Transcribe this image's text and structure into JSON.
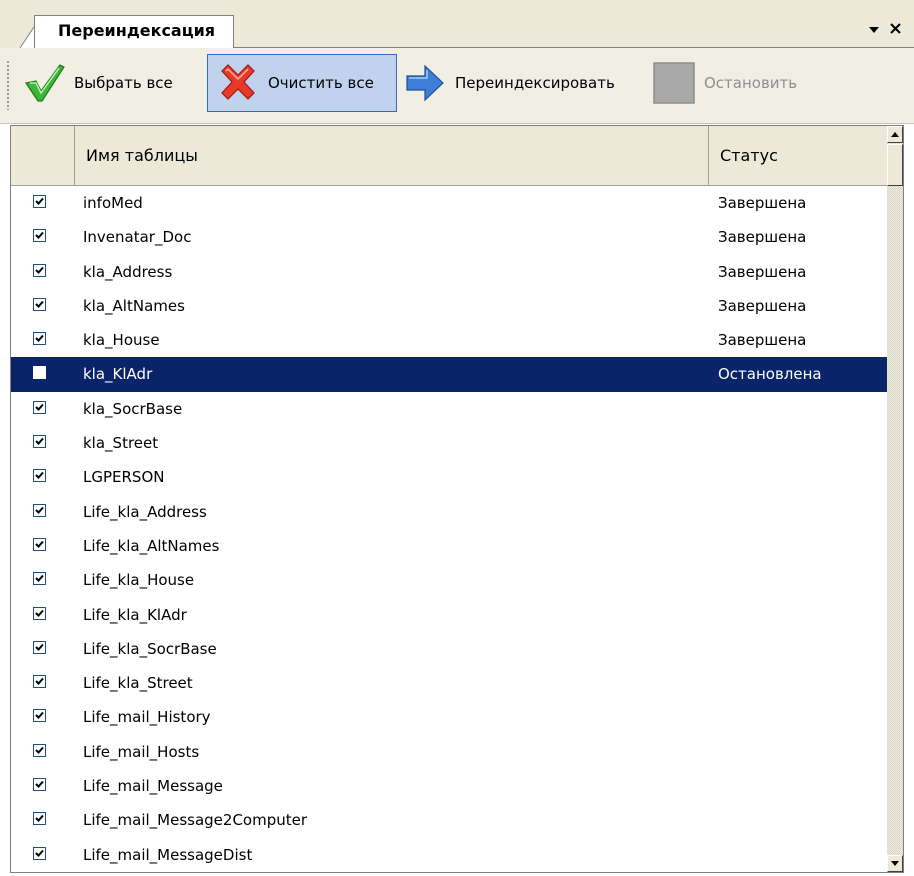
{
  "tab": {
    "title": "Переиндексация"
  },
  "toolbar": {
    "select_all": "Выбрать все",
    "clear_all": "Очистить все",
    "reindex": "Переиндексировать",
    "stop": "Остановить"
  },
  "table": {
    "columns": [
      "",
      "Имя таблицы",
      "Статус"
    ],
    "rows": [
      {
        "checked": true,
        "name": "infoMed",
        "status": "Завершена"
      },
      {
        "checked": true,
        "name": "Invenatar_Doc",
        "status": "Завершена"
      },
      {
        "checked": true,
        "name": "kla_Address",
        "status": "Завершена"
      },
      {
        "checked": true,
        "name": "kla_AltNames",
        "status": "Завершена"
      },
      {
        "checked": true,
        "name": "kla_House",
        "status": "Завершена"
      },
      {
        "checked": true,
        "name": "kla_KlAdr",
        "status": "Остановлена",
        "selected": true
      },
      {
        "checked": true,
        "name": "kla_SocrBase",
        "status": ""
      },
      {
        "checked": true,
        "name": "kla_Street",
        "status": ""
      },
      {
        "checked": true,
        "name": "LGPERSON",
        "status": ""
      },
      {
        "checked": true,
        "name": "Life_kla_Address",
        "status": ""
      },
      {
        "checked": true,
        "name": "Life_kla_AltNames",
        "status": ""
      },
      {
        "checked": true,
        "name": "Life_kla_House",
        "status": ""
      },
      {
        "checked": true,
        "name": "Life_kla_KlAdr",
        "status": ""
      },
      {
        "checked": true,
        "name": "Life_kla_SocrBase",
        "status": ""
      },
      {
        "checked": true,
        "name": "Life_kla_Street",
        "status": ""
      },
      {
        "checked": true,
        "name": "Life_mail_History",
        "status": ""
      },
      {
        "checked": true,
        "name": "Life_mail_Hosts",
        "status": ""
      },
      {
        "checked": true,
        "name": "Life_mail_Message",
        "status": ""
      },
      {
        "checked": true,
        "name": "Life_mail_Message2Computer",
        "status": ""
      },
      {
        "checked": true,
        "name": "Life_mail_MessageDist",
        "status": ""
      }
    ]
  },
  "icons": {
    "select_all": "green-checkmark-icon",
    "clear_all": "red-cross-icon",
    "reindex": "blue-arrow-icon",
    "stop": "gray-square-icon",
    "dropdown": "triangle-down-icon",
    "close": "close-icon"
  },
  "colors": {
    "selection": "#0a246a",
    "toolbar_bg": "#f1efe3",
    "pressed_button": "#c1d2ee"
  }
}
